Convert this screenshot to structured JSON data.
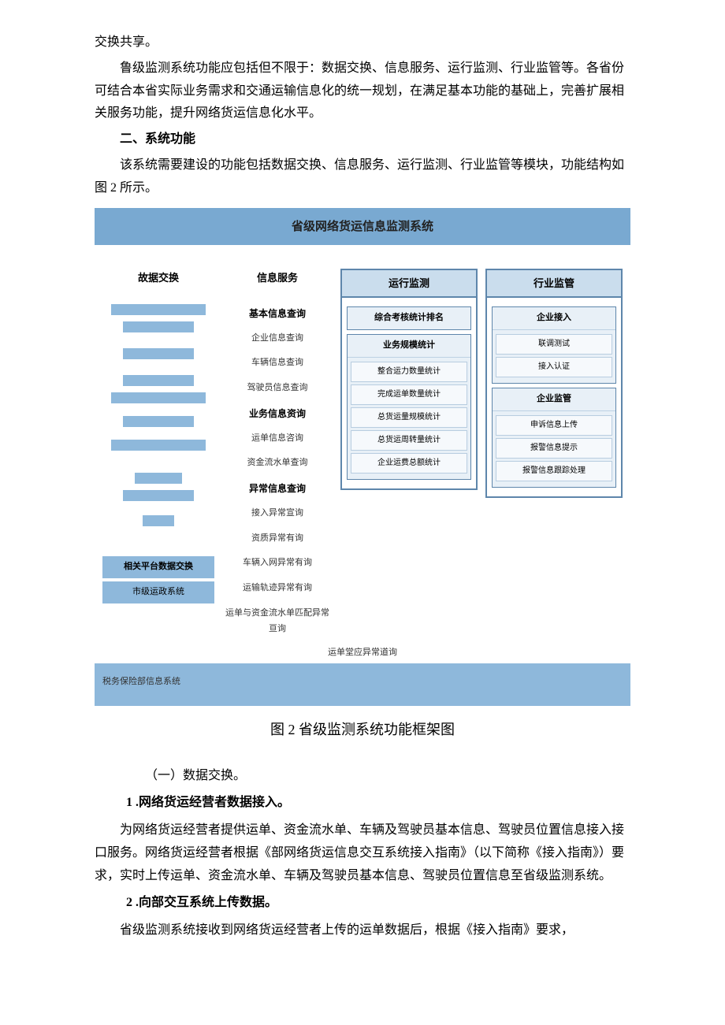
{
  "p1": "交换共享。",
  "p2": "鲁级监测系统功能应包括但不限于：数据交换、信息服务、运行监测、行业监管等。各省份可结合本省实际业务需求和交通运输信息化的统一规划，在满足基本功能的基础上，完善扩展相关服务功能，提升网络货运信息化水平。",
  "h2": "二、系统功能",
  "p3": "该系统需要建设的功能包括数据交换、信息服务、运行监测、行业监管等模块，功能结构如图 2 所示。",
  "diagram_title": "省级网络货运信息监测系统",
  "col1": {
    "header": "故据交换",
    "label1": "相关平台数据交换",
    "label2": "市级运政系统"
  },
  "col2": {
    "header": "信息服务",
    "sec1": "基本信息查询",
    "i1": "企业信息查询",
    "i2": "车辆信息查询",
    "i3": "驾驶员信息查询",
    "sec2": "业务信息资询",
    "i4": "运单信息咨询",
    "i5": "资金流水单查询",
    "sec3": "异常信息查询",
    "i6": "接入异常宣询",
    "i7": "资质异常有询",
    "i8": "车辆入网异常有询",
    "i9": "运输轨迹异常有询",
    "i10": "运单与资金流水单匹配异常亘询"
  },
  "span_line": "运单堂应异常道询",
  "col3": {
    "header": "运行监测",
    "s1": "综合考核统计排名",
    "s2": "业务规模统计",
    "s2i": [
      "整合运力数量统计",
      "完成运单数量统计",
      "总货运量规模统计",
      "总货运周转量统计",
      "企业运费总额统计"
    ]
  },
  "col4": {
    "header": "行业监管",
    "s1": "企业接入",
    "s1i": [
      "联调测试",
      "接入认证"
    ],
    "s2": "企业监管",
    "s2i": [
      "申诉信息上传",
      "报警信息提示",
      "报警信息跟踪处理"
    ]
  },
  "footer_bar": "税务保险部信息系统",
  "caption": "图 2 省级监测系统功能框架图",
  "s1": "（一）数据交换。",
  "n1": "1 .网络货运经营者数据接入。",
  "p4": "为网络货运经营者提供运单、资金流水单、车辆及驾驶员基本信息、驾驶员位置信息接入接口服务。网络货运经营者根据《部网络货运信息交互系统接入指南》（以下简称《接入指南》）要求，实时上传运单、资金流水单、车辆及驾驶员基本信息、驾驶员位置信息至省级监测系统。",
  "n2": "2 .向部交互系统上传数据。",
  "p5": "省级监测系统接收到网络货运经营者上传的运单数据后，根据《接入指南》要求，"
}
